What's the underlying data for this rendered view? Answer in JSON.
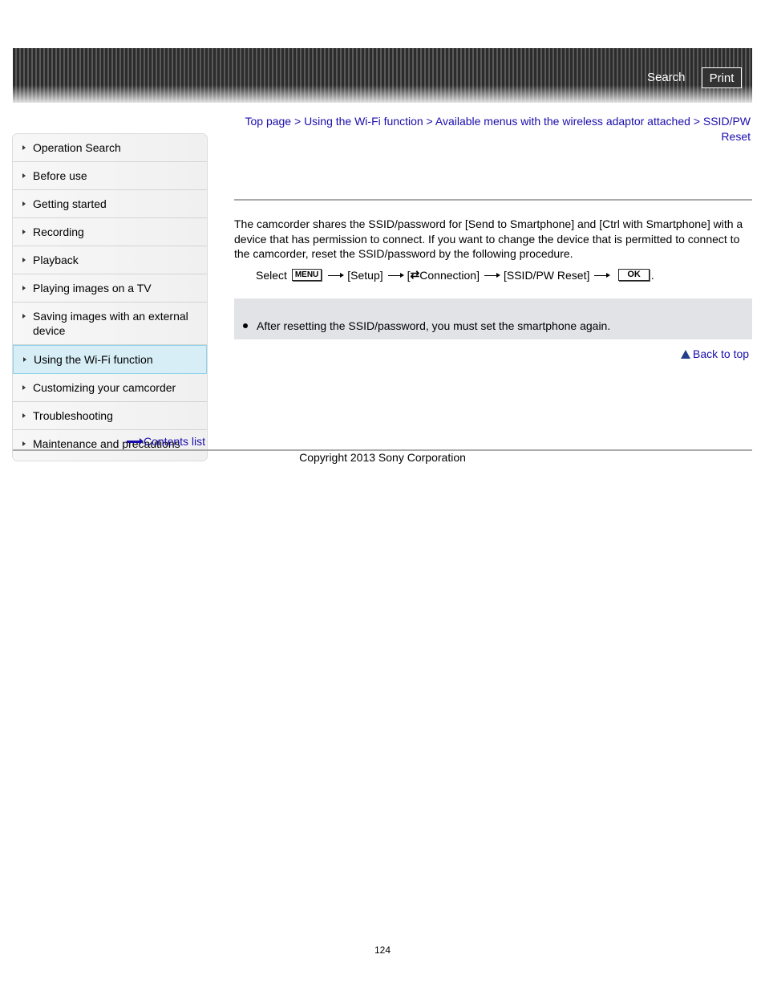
{
  "header": {
    "search_label": "Search",
    "print_label": "Print"
  },
  "sidebar": {
    "items": [
      {
        "label": "Operation Search",
        "active": false
      },
      {
        "label": "Before use",
        "active": false
      },
      {
        "label": "Getting started",
        "active": false
      },
      {
        "label": "Recording",
        "active": false
      },
      {
        "label": "Playback",
        "active": false
      },
      {
        "label": "Playing images on a TV",
        "active": false
      },
      {
        "label": "Saving images with an external device",
        "active": false
      },
      {
        "label": "Using the Wi-Fi function",
        "active": true
      },
      {
        "label": "Customizing your camcorder",
        "active": false
      },
      {
        "label": "Troubleshooting",
        "active": false
      },
      {
        "label": "Maintenance and precautions",
        "active": false
      }
    ],
    "contents_list_label": "Contents list"
  },
  "breadcrumb": {
    "items": [
      "Top page",
      "Using the Wi-Fi function",
      "Available menus with the wireless adaptor attached",
      "SSID/PW Reset"
    ],
    "separator": " > "
  },
  "main": {
    "intro": "The camcorder shares the SSID/password for [Send to Smartphone] and [Ctrl with Smartphone] with a device that has permission to connect. If you want to change the device that is permitted to connect to the camcorder, reset the SSID/password by the following procedure.",
    "step": {
      "prefix": "Select",
      "menu_key": "MENU",
      "setup": "[Setup]",
      "connection_open": "[",
      "connection_icon": "⇄",
      "connection_label": "Connection]",
      "ssid_reset": "[SSID/PW Reset]",
      "ok_key": "OK",
      "suffix": "."
    },
    "note": "After resetting the SSID/password, you must set the smartphone again.",
    "back_to_top": "Back to top"
  },
  "footer": {
    "copyright": "Copyright 2013 Sony Corporation",
    "page_number": "124"
  }
}
